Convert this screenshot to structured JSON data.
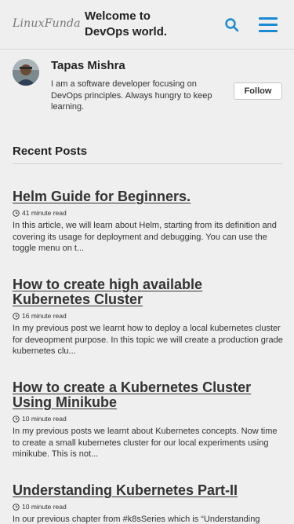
{
  "header": {
    "logo_text": "LinuxFunda",
    "site_title": "Welcome to DevOps world.",
    "accent_color": "#1a8ad1",
    "search_icon": "search-icon",
    "menu_icon": "hamburger-menu-icon"
  },
  "author": {
    "name": "Tapas Mishra",
    "bio": "I am a software developer focusing on DevOps principles. Always hungry to keep learning.",
    "follow_label": "Follow"
  },
  "recent": {
    "heading": "Recent Posts"
  },
  "posts": [
    {
      "title": "Helm Guide for Beginners.",
      "read_time": "41 minute read",
      "excerpt": "In this article, we will learn about Helm, starting from its definition and covering its usage for deployment and debugging. You can use the toggle menu on t..."
    },
    {
      "title": "How to create high available Kubernetes Cluster",
      "read_time": "16 minute read",
      "excerpt": "In my previous post we learnt how to deploy a local kubernetes cluster for deveopment purpose. In this topic we will create a production grade kubernetes clu..."
    },
    {
      "title": "How to create a Kubernetes Cluster Using Minikube",
      "read_time": "10 minute read",
      "excerpt": "In my previous posts we learnt about Kubernetes concepts. Now time to create a small kubernetes cluster for our local experiments using minikube. This is not..."
    },
    {
      "title": "Understanding Kubernetes Part-II",
      "read_time": "10 minute read",
      "excerpt": "In our previous chapter from #k8sSeries which is “Understanding"
    }
  ]
}
